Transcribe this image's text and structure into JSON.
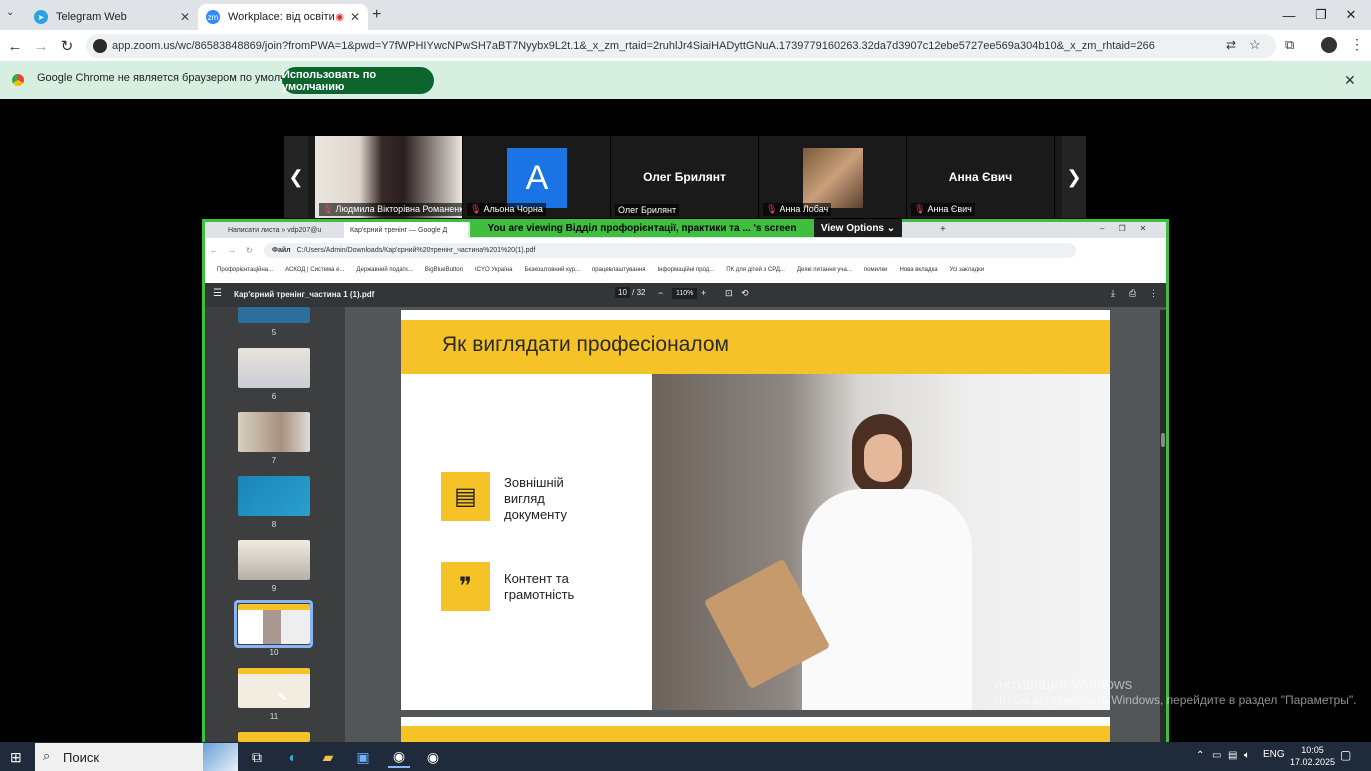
{
  "browser": {
    "tabs": [
      {
        "label": "Telegram Web",
        "active": false
      },
      {
        "label": "Workplace: від освіти до к",
        "active": true
      }
    ],
    "url": "app.zoom.us/wc/86583848869/join?fromPWA=1&pwd=Y7fWPHIYwcNPwSH7aBT7Nyybx9L2t.1&_x_zm_rtaid=2ruhlJr4SiaiHADyttGNuA.1739779160263.32da7d3907c12ebe5727ee569a304b10&_x_zm_rhtaid=266"
  },
  "infobar": {
    "message": "Google Chrome не является браузером по умолчанию.",
    "button": "Использовать по умолчанию"
  },
  "zoom": {
    "participants": [
      {
        "name": "Людмила Вікторівна Романенко",
        "display": "",
        "muted": true,
        "type": "video"
      },
      {
        "name": "Альона Чорна",
        "display": "A",
        "muted": true,
        "type": "avatar"
      },
      {
        "name": "Олег Брилянт",
        "display": "Олег Брилянт",
        "muted": false,
        "type": "name"
      },
      {
        "name": "Анна Лобач",
        "display": "",
        "muted": true,
        "type": "photo"
      },
      {
        "name": "Анна Євич",
        "display": "Анна Євич",
        "muted": true,
        "type": "name"
      }
    ],
    "share_banner": "You are viewing  Відділ профорієнтації, практики та ... 's screen",
    "view_options": "View Options"
  },
  "shared": {
    "tabs": [
      "Написати листа » vdp207@u",
      "Кар'єрний тренінг — Google Д"
    ],
    "path_label": "Файл",
    "path": "C:/Users/Admin/Downloads/Кар'єрний%20тренінг_частина%201%20(1).pdf",
    "bookmarks": [
      "Профорієнтаційна...",
      "АСКОД | Система е...",
      "Державний податк...",
      "BigBlueButton",
      "ICYO Україна",
      "Безкоштовний кур...",
      "працевлаштування",
      "Інформаційні прод...",
      "ПК для дітей з СРД...",
      "Деякі питання уча...",
      "помилки",
      "Нова вкладка",
      "Усі закладки"
    ],
    "pdf": {
      "filename": "Кар'єрний тренінг_частина 1 (1).pdf",
      "page_current": "10",
      "page_total": "/ 32",
      "zoom": "110%",
      "thumbnails": [
        "5",
        "6",
        "7",
        "8",
        "9",
        "10",
        "11"
      ],
      "slide": {
        "title": "Як виглядати професіоналом",
        "items": [
          {
            "text": "Зовнішній вигляд документу",
            "icon": "document-icon"
          },
          {
            "text": "Контент та грамотність",
            "icon": "speech-bubble-icon"
          }
        ]
      }
    }
  },
  "watermark": {
    "line1": "Активация Windows",
    "line2": "Чтобы активировать Windows, перейдите в раздел \"Параметры\"."
  },
  "taskbar": {
    "search": "Поиск",
    "lang": "ENG",
    "time": "10:05",
    "date": "17.02.2025"
  }
}
